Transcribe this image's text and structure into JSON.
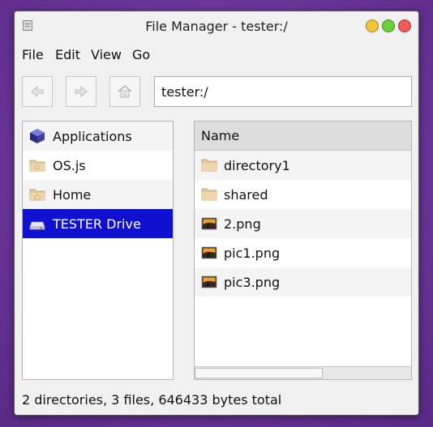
{
  "window": {
    "title": "File Manager - tester:/",
    "controls": [
      "minimize",
      "maximize",
      "close"
    ],
    "colors": {
      "minimize": "#f3c43a",
      "maximize": "#6bcf3a",
      "close": "#ee5b5b"
    }
  },
  "menu": {
    "items": [
      "File",
      "Edit",
      "View",
      "Go"
    ]
  },
  "toolbar": {
    "back_icon": "back-arrow-icon",
    "forward_icon": "forward-arrow-icon",
    "home_icon": "home-icon",
    "path_value": "tester:/"
  },
  "sidebar": {
    "items": [
      {
        "label": "Applications",
        "icon": "applications-cube-icon",
        "selected": false
      },
      {
        "label": "OS.js",
        "icon": "folder-icon",
        "selected": false
      },
      {
        "label": "Home",
        "icon": "home-folder-icon",
        "selected": false
      },
      {
        "label": "TESTER Drive",
        "icon": "drive-icon",
        "selected": true
      }
    ],
    "selected_color": "#1010d0"
  },
  "files": {
    "column_header": "Name",
    "rows": [
      {
        "name": "directory1",
        "icon": "folder-icon"
      },
      {
        "name": "shared",
        "icon": "folder-icon"
      },
      {
        "name": "2.png",
        "icon": "image-icon"
      },
      {
        "name": "pic1.png",
        "icon": "image-icon"
      },
      {
        "name": "pic3.png",
        "icon": "image-icon"
      }
    ]
  },
  "status": {
    "text": "2 directories, 3 files, 646433 bytes total"
  }
}
